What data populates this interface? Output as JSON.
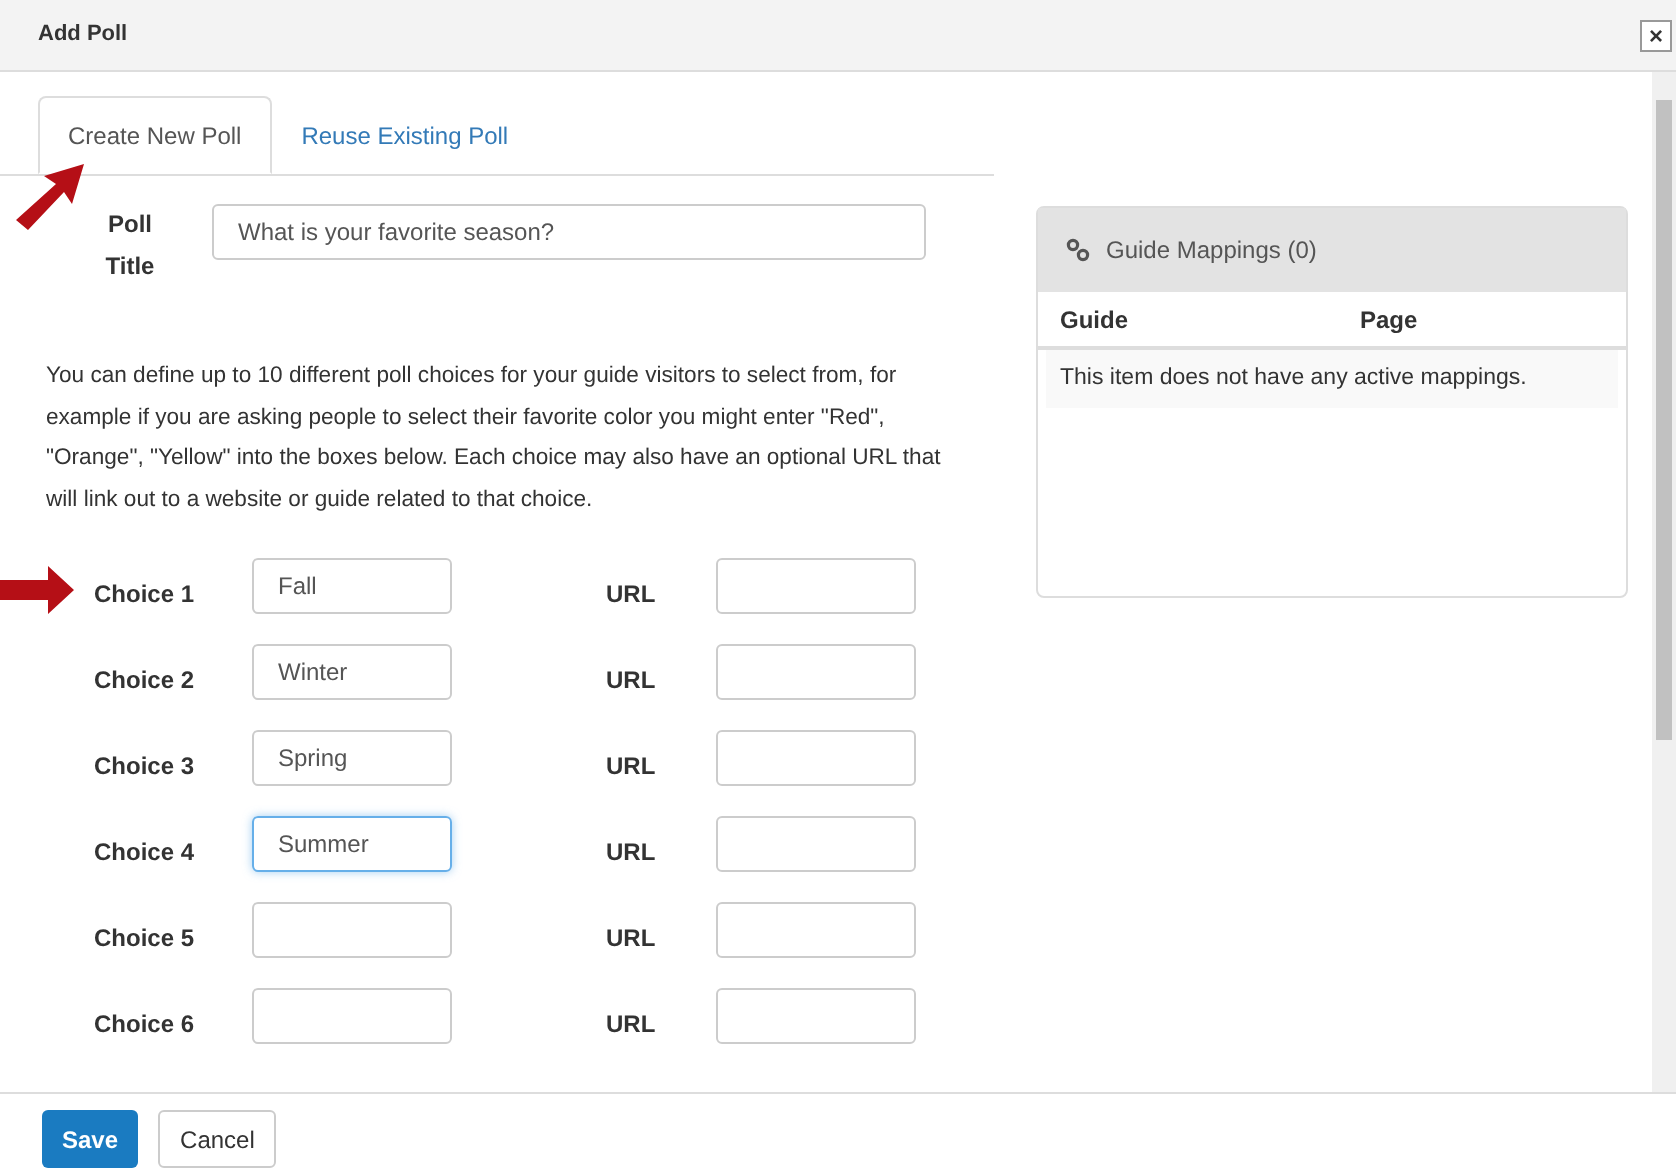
{
  "window": {
    "title": "Add Poll",
    "close": "×"
  },
  "tabs": [
    {
      "label": "Create New Poll",
      "selected": true
    },
    {
      "label": "Reuse Existing Poll",
      "selected": false
    }
  ],
  "poll_title": {
    "label": "Poll Title",
    "value": "What is your favorite season?"
  },
  "description": "You can define up to 10 different poll choices for your guide visitors to select from, for example if you are asking people to select their favorite color you might enter \"Red\", \"Orange\", \"Yellow\" into the boxes below. Each choice may also have an optional URL that will link out to a website or guide related to that choice.",
  "choices": [
    {
      "label": "Choice 1",
      "value": "Fall",
      "focused": false,
      "url_label": "URL"
    },
    {
      "label": "Choice 2",
      "value": "Winter",
      "focused": false,
      "url_label": "URL"
    },
    {
      "label": "Choice 3",
      "value": "Spring",
      "focused": false,
      "url_label": "URL"
    },
    {
      "label": "Choice 4",
      "value": "Summer",
      "focused": true,
      "url_label": "URL"
    },
    {
      "label": "Choice 5",
      "focused": false,
      "url_label": "URL"
    },
    {
      "label": "Choice 6",
      "focused": false,
      "url_label": "URL"
    }
  ],
  "mappings": {
    "title": "Guide Mappings (0)",
    "columns": [
      "Guide",
      "Page"
    ],
    "empty_message": "This item does not have any active mappings."
  },
  "buttons": [
    "Save",
    "Cancel"
  ]
}
